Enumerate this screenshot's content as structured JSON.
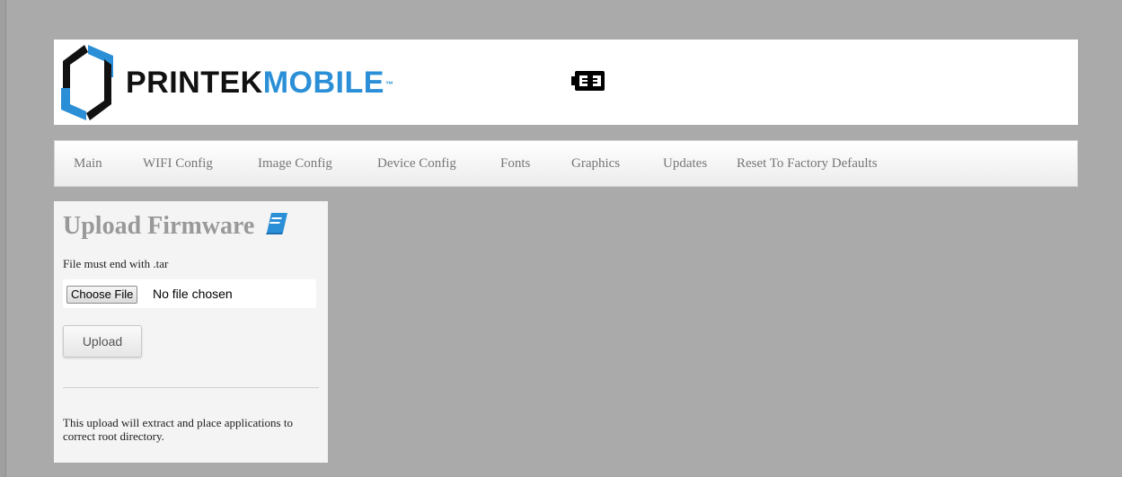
{
  "brand": {
    "name_part1": "PRINTEK",
    "name_part2": "MOBILE",
    "trademark": "™",
    "logo_icon": "printek-logo-mark",
    "status_icon": "battery-icon",
    "colors": {
      "blue": "#2a8fd6",
      "dark": "#111111"
    }
  },
  "nav": {
    "items": [
      {
        "label": "Main"
      },
      {
        "label": "WIFI Config"
      },
      {
        "label": "Image Config"
      },
      {
        "label": "Device Config"
      },
      {
        "label": "Fonts"
      },
      {
        "label": "Graphics"
      },
      {
        "label": "Updates"
      },
      {
        "label": "Reset To Factory Defaults"
      }
    ]
  },
  "upload": {
    "title": "Upload Firmware",
    "title_icon": "book-icon",
    "note": "File must end with .tar",
    "choose_label": "Choose File",
    "no_file_text": "No file chosen",
    "button_label": "Upload",
    "help_text": "This upload will extract and place applications to correct root directory."
  }
}
